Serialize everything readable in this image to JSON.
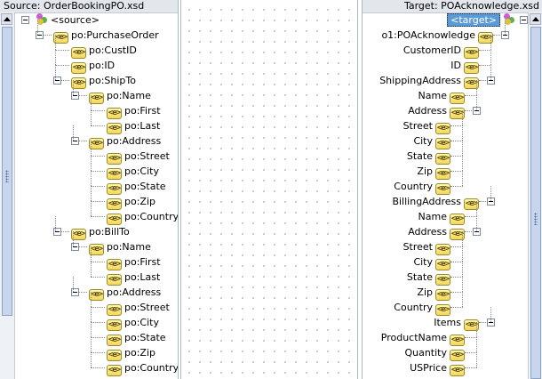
{
  "source": {
    "header": "Source: OrderBookingPO.xsd",
    "root_label": "<source>",
    "nodes": [
      {
        "label": "po:PurchaseOrder",
        "depth": 1,
        "toggle": true
      },
      {
        "label": "po:CustID",
        "depth": 2,
        "toggle": false
      },
      {
        "label": "po:ID",
        "depth": 2,
        "toggle": false
      },
      {
        "label": "po:ShipTo",
        "depth": 2,
        "toggle": true
      },
      {
        "label": "po:Name",
        "depth": 3,
        "toggle": true
      },
      {
        "label": "po:First",
        "depth": 4,
        "toggle": false
      },
      {
        "label": "po:Last",
        "depth": 4,
        "toggle": false
      },
      {
        "label": "po:Address",
        "depth": 3,
        "toggle": true
      },
      {
        "label": "po:Street",
        "depth": 4,
        "toggle": false
      },
      {
        "label": "po:City",
        "depth": 4,
        "toggle": false
      },
      {
        "label": "po:State",
        "depth": 4,
        "toggle": false
      },
      {
        "label": "po:Zip",
        "depth": 4,
        "toggle": false
      },
      {
        "label": "po:Country",
        "depth": 4,
        "toggle": false
      },
      {
        "label": "po:BillTo",
        "depth": 2,
        "toggle": true
      },
      {
        "label": "po:Name",
        "depth": 3,
        "toggle": true
      },
      {
        "label": "po:First",
        "depth": 4,
        "toggle": false
      },
      {
        "label": "po:Last",
        "depth": 4,
        "toggle": false
      },
      {
        "label": "po:Address",
        "depth": 3,
        "toggle": true
      },
      {
        "label": "po:Street",
        "depth": 4,
        "toggle": false
      },
      {
        "label": "po:City",
        "depth": 4,
        "toggle": false
      },
      {
        "label": "po:State",
        "depth": 4,
        "toggle": false
      },
      {
        "label": "po:Zip",
        "depth": 4,
        "toggle": false
      },
      {
        "label": "po:Country",
        "depth": 4,
        "toggle": false
      }
    ]
  },
  "target": {
    "header": "Target: POAcknowledge.xsd",
    "root_label": "<target>",
    "nodes": [
      {
        "label": "o1:POAcknowledge",
        "depth": 1,
        "toggle": true
      },
      {
        "label": "CustomerID",
        "depth": 2,
        "toggle": false
      },
      {
        "label": "ID",
        "depth": 2,
        "toggle": false
      },
      {
        "label": "ShippingAddress",
        "depth": 2,
        "toggle": true
      },
      {
        "label": "Name",
        "depth": 3,
        "toggle": false
      },
      {
        "label": "Address",
        "depth": 3,
        "toggle": true
      },
      {
        "label": "Street",
        "depth": 4,
        "toggle": false
      },
      {
        "label": "City",
        "depth": 4,
        "toggle": false
      },
      {
        "label": "State",
        "depth": 4,
        "toggle": false
      },
      {
        "label": "Zip",
        "depth": 4,
        "toggle": false
      },
      {
        "label": "Country",
        "depth": 4,
        "toggle": false
      },
      {
        "label": "BillingAddress",
        "depth": 2,
        "toggle": true
      },
      {
        "label": "Name",
        "depth": 3,
        "toggle": false
      },
      {
        "label": "Address",
        "depth": 3,
        "toggle": true
      },
      {
        "label": "Street",
        "depth": 4,
        "toggle": false
      },
      {
        "label": "City",
        "depth": 4,
        "toggle": false
      },
      {
        "label": "State",
        "depth": 4,
        "toggle": false
      },
      {
        "label": "Zip",
        "depth": 4,
        "toggle": false
      },
      {
        "label": "Country",
        "depth": 4,
        "toggle": false
      },
      {
        "label": "Items",
        "depth": 2,
        "toggle": true
      },
      {
        "label": "ProductName",
        "depth": 3,
        "toggle": false
      },
      {
        "label": "Quantity",
        "depth": 3,
        "toggle": false
      },
      {
        "label": "USPrice",
        "depth": 3,
        "toggle": false
      }
    ]
  },
  "icons": {
    "element": "element-icon",
    "root": "schema-root-icon",
    "toggle": "collapse-toggle-icon"
  },
  "colors": {
    "header_bg": "#e3e6ec",
    "selection": "#5b9bd5",
    "element_icon": "#f3d65a"
  }
}
